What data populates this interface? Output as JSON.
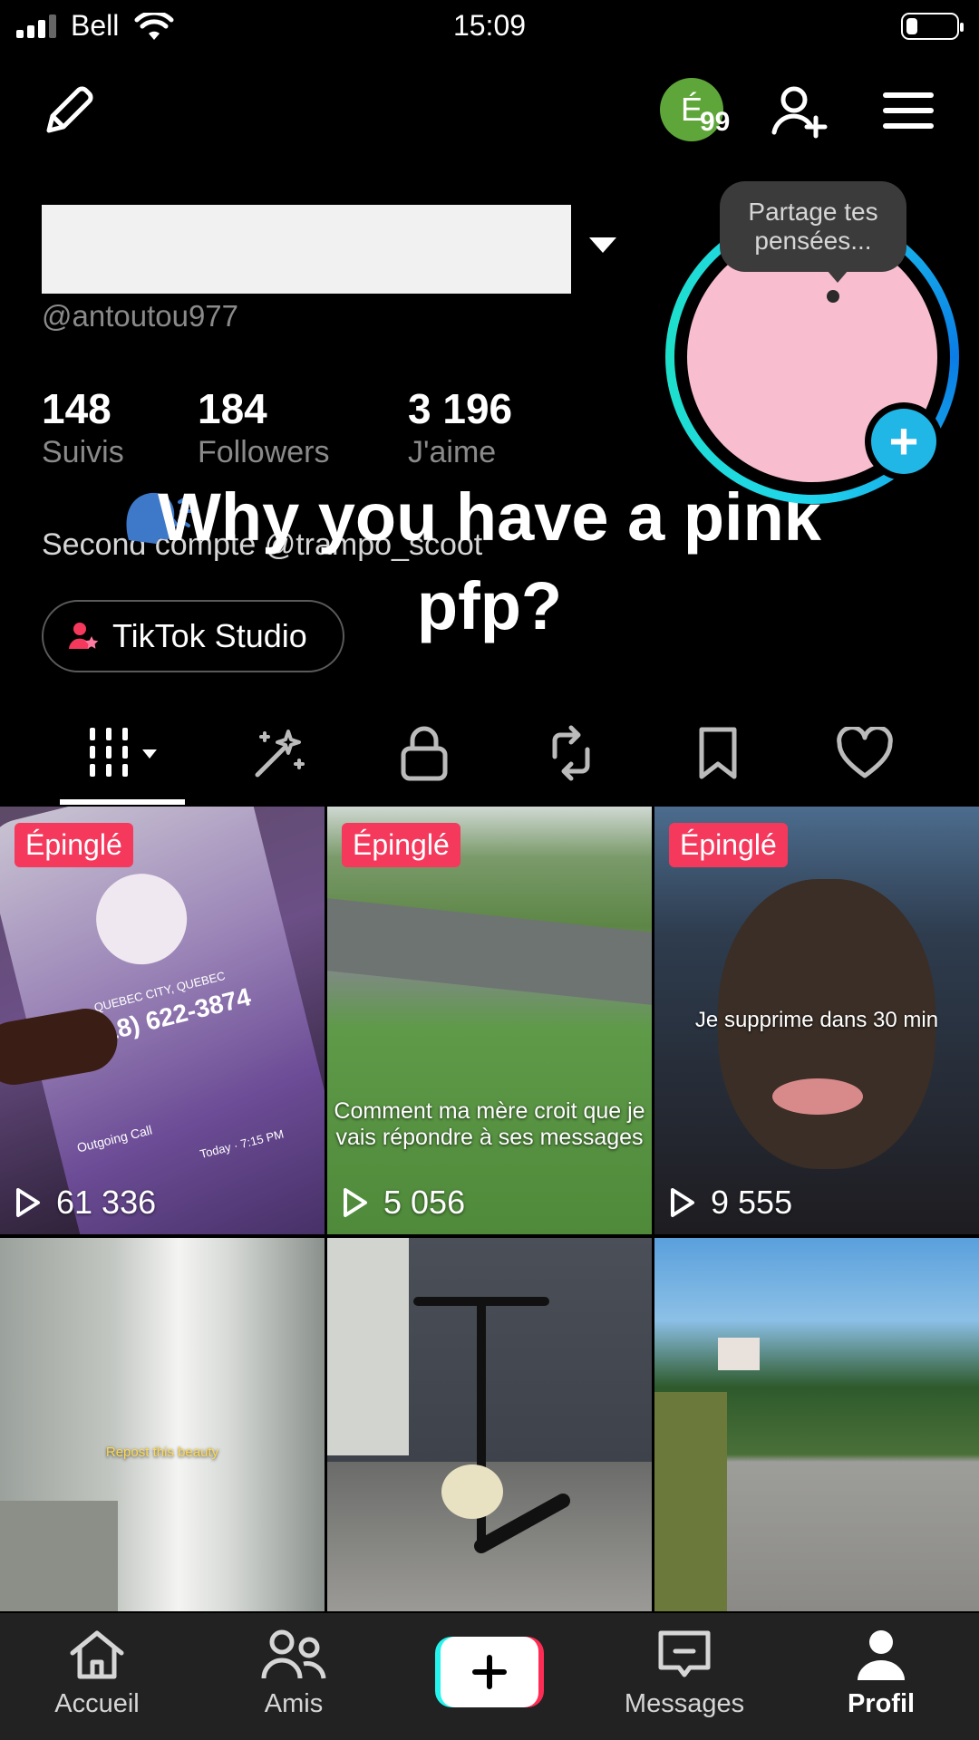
{
  "status_bar": {
    "carrier": "Bell",
    "time": "15:09"
  },
  "header": {
    "notification_initial": "É",
    "notification_count": "99"
  },
  "profile": {
    "username": "@antoutou977",
    "stats": [
      {
        "value": "148",
        "label": "Suivis"
      },
      {
        "value": "184",
        "label": "Followers"
      },
      {
        "value": "3 196",
        "label": "J'aime"
      }
    ],
    "bio": "Second compte @trampo_scoot",
    "studio_label": "TikTok Studio",
    "thought_bubble": "Partage tes pensées...",
    "avatar_color": "#f8bed0"
  },
  "overlay": {
    "line1": "Why you have a pink",
    "line2": "pfp?"
  },
  "tabs": [
    "grid-icon",
    "sparkle-icon",
    "lock-icon",
    "repost-icon",
    "bookmark-icon",
    "heart-icon"
  ],
  "videos": [
    {
      "pinned": "Épinglé",
      "views": "61 336",
      "phone_number": "(418) 622-3874",
      "phone_location": "QUEBEC CITY, QUEBEC",
      "phone_meta": [
        "Outgoing Call",
        "Today · 7:15 PM"
      ]
    },
    {
      "pinned": "Épinglé",
      "views": "5 056",
      "caption": "Comment ma mère croit que je vais répondre à ses messages"
    },
    {
      "pinned": "Épinglé",
      "views": "9 555",
      "caption": "Je supprime dans 30 min"
    },
    {
      "caption": "Repost this beauty"
    },
    {},
    {}
  ],
  "nav": [
    {
      "label": "Accueil"
    },
    {
      "label": "Amis"
    },
    {
      "label": "Messages"
    },
    {
      "label": "Profil"
    }
  ],
  "colors": {
    "accent": "#f5395c",
    "ring": "#20d5ec",
    "plus": "#20b6e6"
  }
}
